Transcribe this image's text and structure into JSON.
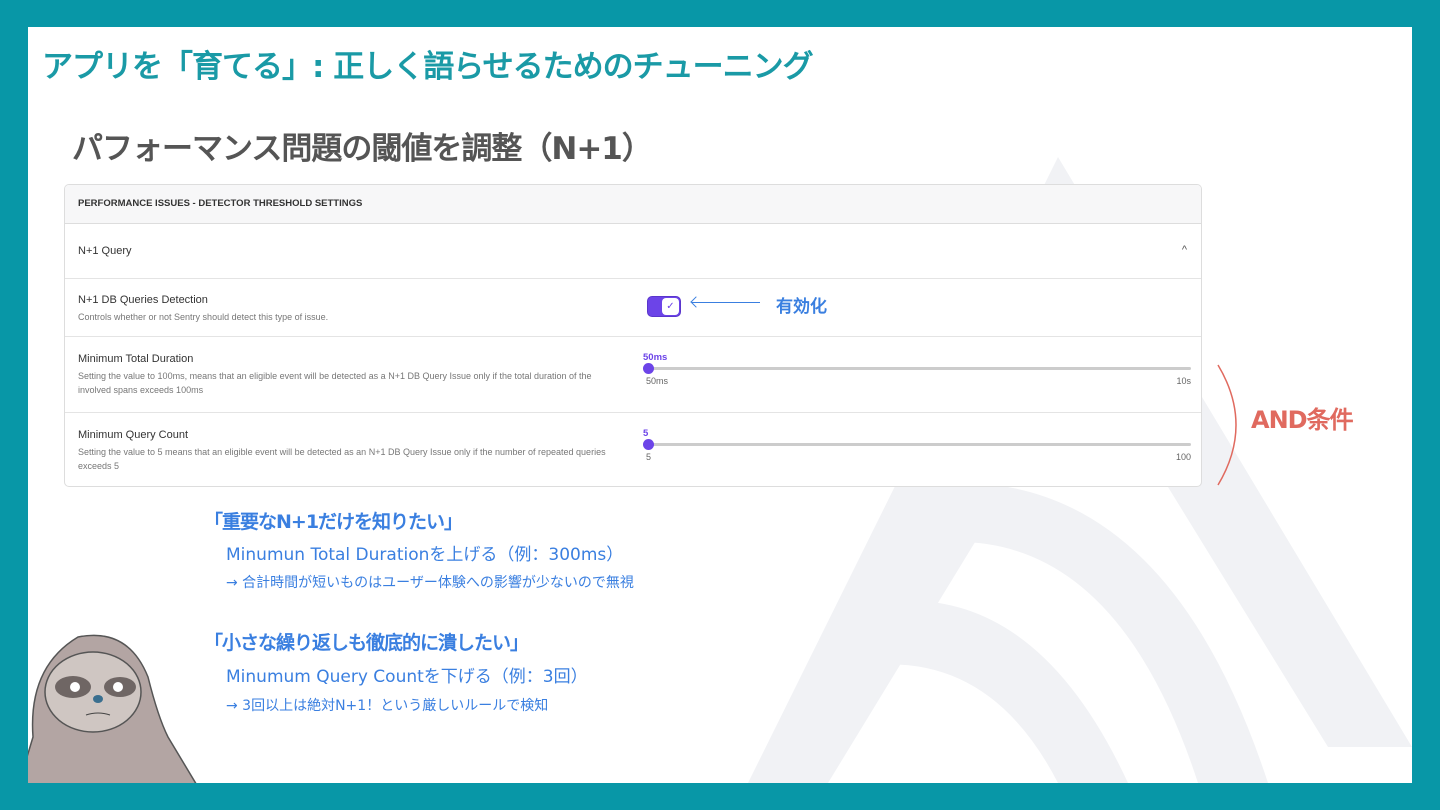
{
  "title": "アプリを「育てる」: 正しく語らせるためのチューニング",
  "subtitle": "パフォーマンス問題の閾値を調整（N+1）",
  "panel": {
    "header": "PERFORMANCE ISSUES - DETECTOR THRESHOLD SETTINGS",
    "section": "N+1 Query",
    "chevron": "^",
    "detection": {
      "label": "N+1 DB Queries Detection",
      "desc": "Controls whether or not Sentry should detect this type of issue.",
      "enabled": true,
      "check": "✓"
    },
    "duration": {
      "label": "Minimum Total Duration",
      "desc": "Setting the value to 100ms, means that an eligible event will be detected as a N+1 DB Query Issue only if the total duration of the involved spans exceeds 100ms",
      "value": "50ms",
      "min": "50ms",
      "max": "10s",
      "fraction": 0
    },
    "count": {
      "label": "Minimum Query Count",
      "desc": "Setting the value to 5 means that an eligible event will be detected as an N+1 DB Query Issue only if the number of repeated queries exceeds 5",
      "value": "5",
      "min": "5",
      "max": "100",
      "fraction": 0
    }
  },
  "annotations": {
    "enable": "有効化",
    "and": "AND条件"
  },
  "notes": [
    {
      "heading": "「重要なN+1だけを知りたい」",
      "line": "Minumun Total Durationを上げる（例：300ms）",
      "sub": "→ 合計時間が短いものはユーザー体験への影響が少ないので無視"
    },
    {
      "heading": "「小さな繰り返しも徹底的に潰したい」",
      "line": "Minumum Query Countを下げる（例：3回）",
      "sub": "→ 3回以上は絶対N+1！という厳しいルールで検知"
    }
  ],
  "colors": {
    "frame": "#0897a7",
    "title": "#1a9aa6",
    "accent": "#6c44e8",
    "note": "#3a7fe0",
    "and": "#e06a5f"
  }
}
